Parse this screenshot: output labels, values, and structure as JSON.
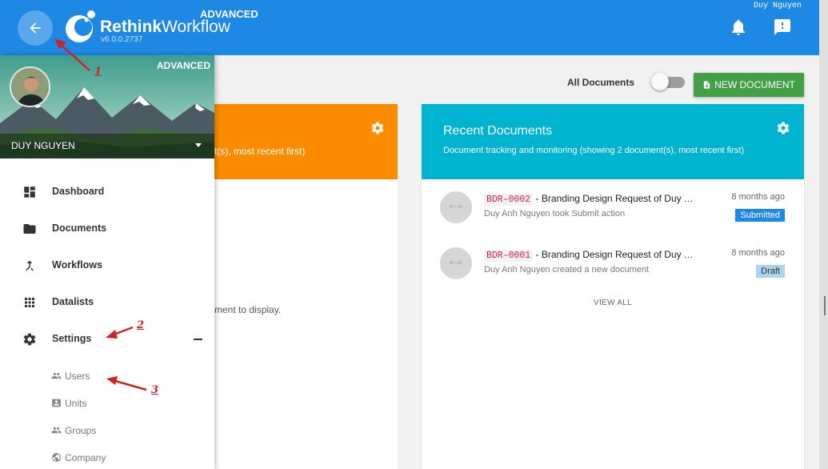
{
  "header": {
    "brand_bold": "Rethink",
    "brand_rest": "Workflow",
    "version": "v6.0.0.2737",
    "edition": "ADVANCED",
    "user_name": "Duy Nguyen"
  },
  "toolbar": {
    "all_documents_label": "All Documents",
    "toggle_on": false,
    "new_document_label": "NEW DOCUMENT"
  },
  "left_card": {
    "subtitle_fragment": "t(s), most recent first)",
    "empty_fragment": "ment to display."
  },
  "recent_card": {
    "title": "Recent Documents",
    "subtitle": "Document tracking and monitoring (showing 2 document(s), most recent first)",
    "view_all": "VIEW ALL",
    "documents": [
      {
        "avatar_text": "60 x 60",
        "code": "BDR–0002",
        "title": " - Branding Design Request of Duy Anh Nguyen",
        "action": "Duy Anh Nguyen took Submit action",
        "time": "8 months ago",
        "status": "Submitted"
      },
      {
        "avatar_text": "60 x 60",
        "code": "BDR–0001",
        "title": " - Branding Design Request of Duy Anh Nguyen",
        "action": "Duy Anh Nguyen created a new document",
        "time": "8 months ago",
        "status": "Draft"
      }
    ]
  },
  "drawer": {
    "edition": "ADVANCED",
    "user_name": "DUY NGUYEN",
    "nav": [
      {
        "label": "Dashboard",
        "icon": "dashboard-icon"
      },
      {
        "label": "Documents",
        "icon": "folder-icon"
      },
      {
        "label": "Workflows",
        "icon": "merge-icon"
      },
      {
        "label": "Datalists",
        "icon": "grid-icon"
      },
      {
        "label": "Settings",
        "icon": "gear-icon",
        "expanded": true
      }
    ],
    "settings_sub": [
      {
        "label": "Users",
        "icon": "people-icon"
      },
      {
        "label": "Units",
        "icon": "contact-card-icon"
      },
      {
        "label": "Groups",
        "icon": "people-icon"
      },
      {
        "label": "Company",
        "icon": "globe-icon"
      }
    ]
  },
  "annotations": [
    "1",
    "2",
    "3"
  ],
  "colors": {
    "appbar": "#1e88e5",
    "orange_card": "#fb8c00",
    "cyan_card": "#00b4d0",
    "new_doc_button": "#43a047",
    "status_submitted": "#1e88e5",
    "status_draft": "#a8d4f0",
    "annotation": "#d32020"
  }
}
